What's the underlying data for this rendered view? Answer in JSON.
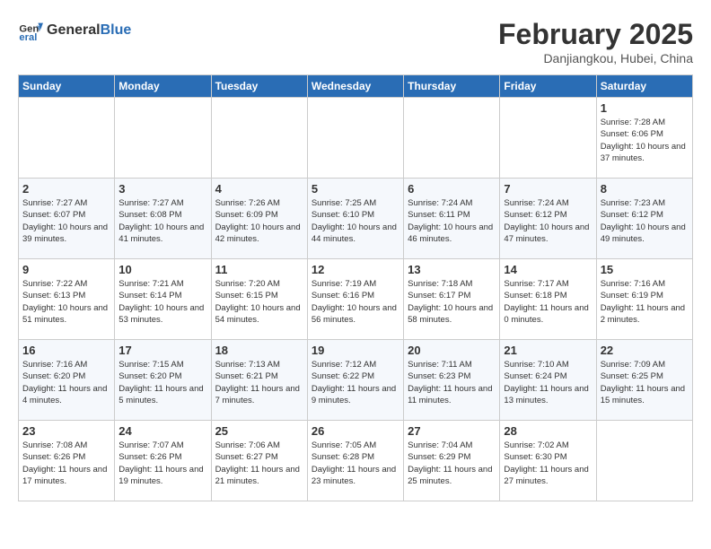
{
  "header": {
    "logo_line1": "General",
    "logo_line2": "Blue",
    "month_year": "February 2025",
    "location": "Danjiangkou, Hubei, China"
  },
  "days_of_week": [
    "Sunday",
    "Monday",
    "Tuesday",
    "Wednesday",
    "Thursday",
    "Friday",
    "Saturday"
  ],
  "weeks": [
    [
      {
        "day": "",
        "info": ""
      },
      {
        "day": "",
        "info": ""
      },
      {
        "day": "",
        "info": ""
      },
      {
        "day": "",
        "info": ""
      },
      {
        "day": "",
        "info": ""
      },
      {
        "day": "",
        "info": ""
      },
      {
        "day": "1",
        "info": "Sunrise: 7:28 AM\nSunset: 6:06 PM\nDaylight: 10 hours and 37 minutes."
      }
    ],
    [
      {
        "day": "2",
        "info": "Sunrise: 7:27 AM\nSunset: 6:07 PM\nDaylight: 10 hours and 39 minutes."
      },
      {
        "day": "3",
        "info": "Sunrise: 7:27 AM\nSunset: 6:08 PM\nDaylight: 10 hours and 41 minutes."
      },
      {
        "day": "4",
        "info": "Sunrise: 7:26 AM\nSunset: 6:09 PM\nDaylight: 10 hours and 42 minutes."
      },
      {
        "day": "5",
        "info": "Sunrise: 7:25 AM\nSunset: 6:10 PM\nDaylight: 10 hours and 44 minutes."
      },
      {
        "day": "6",
        "info": "Sunrise: 7:24 AM\nSunset: 6:11 PM\nDaylight: 10 hours and 46 minutes."
      },
      {
        "day": "7",
        "info": "Sunrise: 7:24 AM\nSunset: 6:12 PM\nDaylight: 10 hours and 47 minutes."
      },
      {
        "day": "8",
        "info": "Sunrise: 7:23 AM\nSunset: 6:12 PM\nDaylight: 10 hours and 49 minutes."
      }
    ],
    [
      {
        "day": "9",
        "info": "Sunrise: 7:22 AM\nSunset: 6:13 PM\nDaylight: 10 hours and 51 minutes."
      },
      {
        "day": "10",
        "info": "Sunrise: 7:21 AM\nSunset: 6:14 PM\nDaylight: 10 hours and 53 minutes."
      },
      {
        "day": "11",
        "info": "Sunrise: 7:20 AM\nSunset: 6:15 PM\nDaylight: 10 hours and 54 minutes."
      },
      {
        "day": "12",
        "info": "Sunrise: 7:19 AM\nSunset: 6:16 PM\nDaylight: 10 hours and 56 minutes."
      },
      {
        "day": "13",
        "info": "Sunrise: 7:18 AM\nSunset: 6:17 PM\nDaylight: 10 hours and 58 minutes."
      },
      {
        "day": "14",
        "info": "Sunrise: 7:17 AM\nSunset: 6:18 PM\nDaylight: 11 hours and 0 minutes."
      },
      {
        "day": "15",
        "info": "Sunrise: 7:16 AM\nSunset: 6:19 PM\nDaylight: 11 hours and 2 minutes."
      }
    ],
    [
      {
        "day": "16",
        "info": "Sunrise: 7:16 AM\nSunset: 6:20 PM\nDaylight: 11 hours and 4 minutes."
      },
      {
        "day": "17",
        "info": "Sunrise: 7:15 AM\nSunset: 6:20 PM\nDaylight: 11 hours and 5 minutes."
      },
      {
        "day": "18",
        "info": "Sunrise: 7:13 AM\nSunset: 6:21 PM\nDaylight: 11 hours and 7 minutes."
      },
      {
        "day": "19",
        "info": "Sunrise: 7:12 AM\nSunset: 6:22 PM\nDaylight: 11 hours and 9 minutes."
      },
      {
        "day": "20",
        "info": "Sunrise: 7:11 AM\nSunset: 6:23 PM\nDaylight: 11 hours and 11 minutes."
      },
      {
        "day": "21",
        "info": "Sunrise: 7:10 AM\nSunset: 6:24 PM\nDaylight: 11 hours and 13 minutes."
      },
      {
        "day": "22",
        "info": "Sunrise: 7:09 AM\nSunset: 6:25 PM\nDaylight: 11 hours and 15 minutes."
      }
    ],
    [
      {
        "day": "23",
        "info": "Sunrise: 7:08 AM\nSunset: 6:26 PM\nDaylight: 11 hours and 17 minutes."
      },
      {
        "day": "24",
        "info": "Sunrise: 7:07 AM\nSunset: 6:26 PM\nDaylight: 11 hours and 19 minutes."
      },
      {
        "day": "25",
        "info": "Sunrise: 7:06 AM\nSunset: 6:27 PM\nDaylight: 11 hours and 21 minutes."
      },
      {
        "day": "26",
        "info": "Sunrise: 7:05 AM\nSunset: 6:28 PM\nDaylight: 11 hours and 23 minutes."
      },
      {
        "day": "27",
        "info": "Sunrise: 7:04 AM\nSunset: 6:29 PM\nDaylight: 11 hours and 25 minutes."
      },
      {
        "day": "28",
        "info": "Sunrise: 7:02 AM\nSunset: 6:30 PM\nDaylight: 11 hours and 27 minutes."
      },
      {
        "day": "",
        "info": ""
      }
    ]
  ]
}
